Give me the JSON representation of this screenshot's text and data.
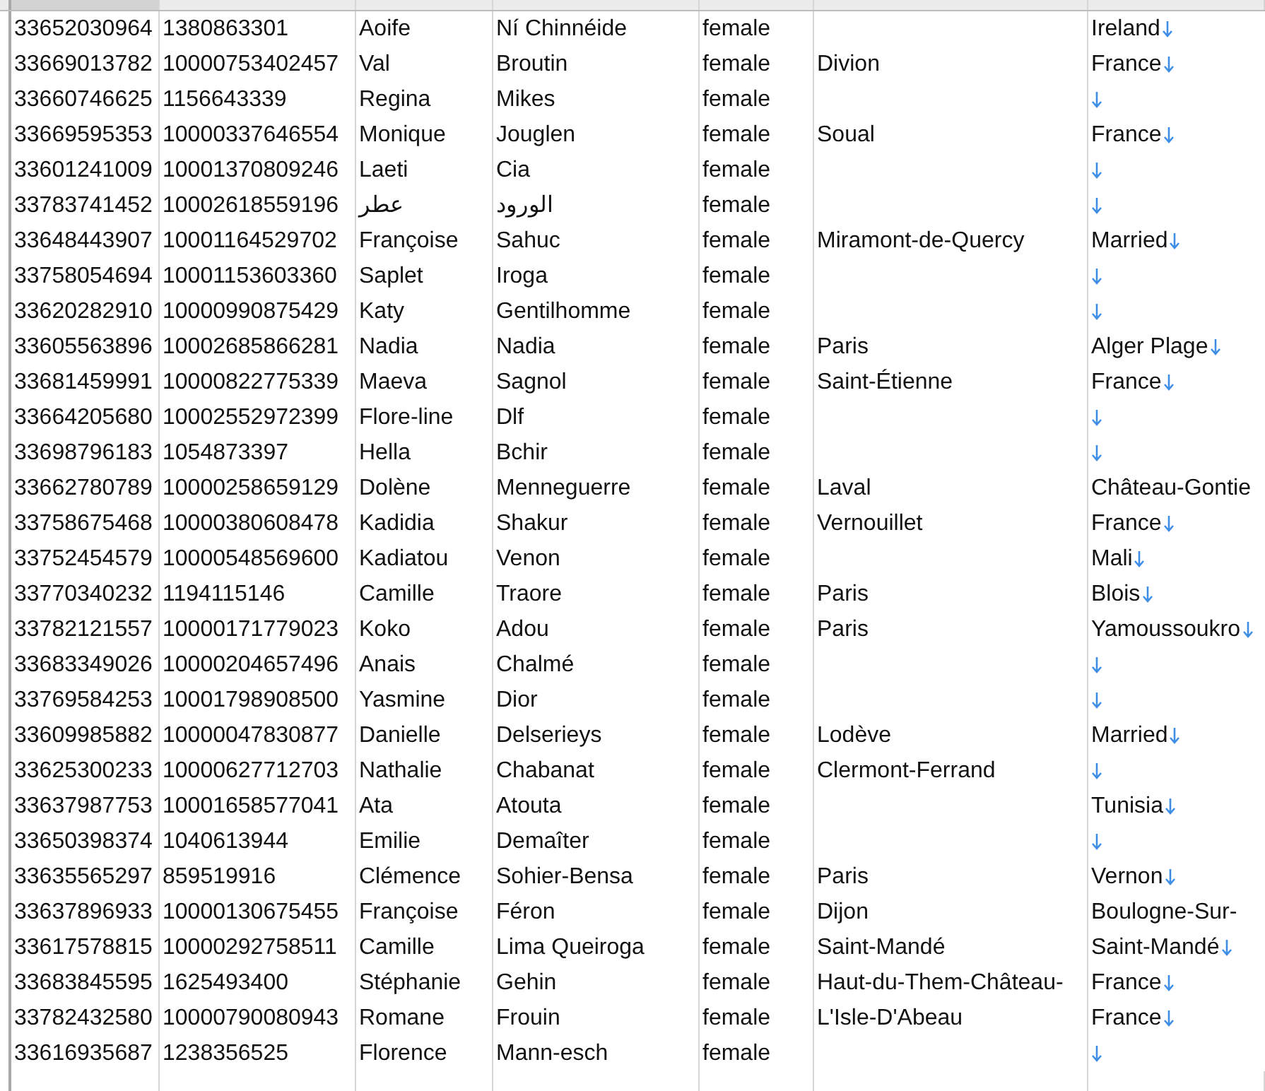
{
  "rows": [
    {
      "column_1": "33652030964",
      "column_2": "1380863301",
      "column_3": "Aoife",
      "column_4": "Ní Chinnéide",
      "column_5": "female",
      "column_7": {
        "text": "Ireland",
        "line_break": true
      }
    },
    {
      "column_1": "33669013782",
      "column_2": "10000753402457",
      "column_3": "Val",
      "column_4": "Broutin",
      "column_5": "female",
      "column_6": "Divion",
      "column_7": {
        "text": "France",
        "line_break": true
      }
    },
    {
      "column_1": "33660746625",
      "column_2": "1156643339",
      "column_3": "Regina",
      "column_4": "Mikes",
      "column_5": "female",
      "column_7": {
        "line_break": true
      }
    },
    {
      "column_1": "33669595353",
      "column_2": "10000337646554",
      "column_3": "Monique",
      "column_4": "Jouglen",
      "column_5": "female",
      "column_6": "Soual",
      "column_7": {
        "text": "France",
        "line_break": true
      }
    },
    {
      "column_1": "33601241009",
      "column_2": "10001370809246",
      "column_3": "Laeti",
      "column_4": "Cia",
      "column_5": "female",
      "column_7": {
        "line_break": true
      }
    },
    {
      "column_1": "33783741452",
      "column_2": "10002618559196",
      "column_3": "عطر",
      "column_4": "الورود",
      "column_5": "female",
      "column_7": {
        "line_break": true
      }
    },
    {
      "column_1": "33648443907",
      "column_2": "10001164529702",
      "column_3": "Françoise",
      "column_4": "Sahuc",
      "column_5": "female",
      "column_6": "Miramont-de-Quercy",
      "column_7": {
        "text": "Married",
        "line_break": true
      }
    },
    {
      "column_1": "33758054694",
      "column_2": "10001153603360",
      "column_3": "Saplet",
      "column_4": "Iroga",
      "column_5": "female",
      "column_7": {
        "line_break": true
      }
    },
    {
      "column_1": "33620282910",
      "column_2": "10000990875429",
      "column_3": "Katy",
      "column_4": "Gentilhomme",
      "column_5": "female",
      "column_7": {
        "line_break": true
      }
    },
    {
      "column_1": "33605563896",
      "column_2": "10002685866281",
      "column_3": "Nadia",
      "column_4": "Nadia",
      "column_5": "female",
      "column_6": "Paris",
      "column_7": {
        "text": "Alger Plage",
        "line_break": true
      }
    },
    {
      "column_1": "33681459991",
      "column_2": "10000822775339",
      "column_3": "Maeva",
      "column_4": "Sagnol",
      "column_5": "female",
      "column_6": "Saint-Étienne",
      "column_7": {
        "text": "France",
        "line_break": true
      }
    },
    {
      "column_1": "33664205680",
      "column_2": "10002552972399",
      "column_3": "Flore-line",
      "column_4": "Dlf",
      "column_5": "female",
      "column_7": {
        "line_break": true
      }
    },
    {
      "column_1": "33698796183",
      "column_2": "1054873397",
      "column_3": "Hella",
      "column_4": "Bchir",
      "column_5": "female",
      "column_7": {
        "line_break": true
      }
    },
    {
      "column_1": "33662780789",
      "column_2": "10000258659129",
      "column_3": "Dolène",
      "column_4": "Menneguerre",
      "column_5": "female",
      "column_6": "Laval",
      "column_7": {
        "text": "Château-Gontie",
        "line_break": false
      }
    },
    {
      "column_1": "33758675468",
      "column_2": "10000380608478",
      "column_3": "Kadidia",
      "column_4": "Shakur",
      "column_5": "female",
      "column_6": "Vernouillet",
      "column_7": {
        "text": "France",
        "line_break": true
      }
    },
    {
      "column_1": "33752454579",
      "column_2": "10000548569600",
      "column_3": "Kadiatou",
      "column_4": "Venon",
      "column_5": "female",
      "column_7": {
        "text": "Mali",
        "line_break": true
      }
    },
    {
      "column_1": "33770340232",
      "column_2": "1194115146",
      "column_3": "Camille",
      "column_4": "Traore",
      "column_5": "female",
      "column_6": "Paris",
      "column_7": {
        "text": "Blois",
        "line_break": true
      }
    },
    {
      "column_1": "33782121557",
      "column_2": "10000171779023",
      "column_3": "Koko",
      "column_4": "Adou",
      "column_5": "female",
      "column_6": "Paris",
      "column_7": {
        "text": "Yamoussoukro",
        "line_break": true
      }
    },
    {
      "column_1": "33683349026",
      "column_2": "10000204657496",
      "column_3": "Anais",
      "column_4": "Chalmé",
      "column_5": "female",
      "column_7": {
        "line_break": true
      }
    },
    {
      "column_1": "33769584253",
      "column_2": "10001798908500",
      "column_3": "Yasmine",
      "column_4": "Dior",
      "column_5": "female",
      "column_7": {
        "line_break": true
      }
    },
    {
      "column_1": "33609985882",
      "column_2": "10000047830877",
      "column_3": "Danielle",
      "column_4": "Delserieys",
      "column_5": "female",
      "column_6": "Lodève",
      "column_7": {
        "text": "Married",
        "line_break": true
      }
    },
    {
      "column_1": "33625300233",
      "column_2": "10000627712703",
      "column_3": "Nathalie",
      "column_4": "Chabanat",
      "column_5": "female",
      "column_6": "Clermont-Ferrand",
      "column_7": {
        "line_break": true
      }
    },
    {
      "column_1": "33637987753",
      "column_2": "10001658577041",
      "column_3": "Ata",
      "column_4": "Atouta",
      "column_5": "female",
      "column_7": {
        "text": "Tunisia",
        "line_break": true
      }
    },
    {
      "column_1": "33650398374",
      "column_2": "1040613944",
      "column_3": "Emilie",
      "column_4": "Demaîter",
      "column_5": "female",
      "column_7": {
        "line_break": true
      }
    },
    {
      "column_1": "33635565297",
      "column_2": "859519916",
      "column_3": "Clémence",
      "column_4": "Sohier-Bensa",
      "column_5": "female",
      "column_6": "Paris",
      "column_7": {
        "text": "Vernon",
        "line_break": true
      }
    },
    {
      "column_1": "33637896933",
      "column_2": "10000130675455",
      "column_3": "Françoise",
      "column_4": "Féron",
      "column_5": "female",
      "column_6": "Dijon",
      "column_7": {
        "text": "Boulogne-Sur-",
        "line_break": false
      }
    },
    {
      "column_1": "33617578815",
      "column_2": "10000292758511",
      "column_3": "Camille",
      "column_4": "Lima Queiroga",
      "column_5": "female",
      "column_6": "Saint-Mandé",
      "column_7": {
        "text": "Saint-Mandé",
        "line_break": true
      }
    },
    {
      "column_1": "33683845595",
      "column_2": "1625493400",
      "column_3": "Stéphanie",
      "column_4": "Gehin",
      "column_5": "female",
      "column_6": "Haut-du-Them-Château-",
      "column_7": {
        "text": "France",
        "line_break": true
      }
    },
    {
      "column_1": "33782432580",
      "column_2": "10000790080943",
      "column_3": "Romane",
      "column_4": "Frouin",
      "column_5": "female",
      "column_6": "L'Isle-D'Abeau",
      "column_7": {
        "text": "France",
        "line_break": true
      }
    },
    {
      "column_1": "33616935687",
      "column_2": "1238356525",
      "column_3": "Florence",
      "column_4": "Mann-esch",
      "column_5": "female",
      "column_7": {
        "line_break": true
      }
    }
  ]
}
